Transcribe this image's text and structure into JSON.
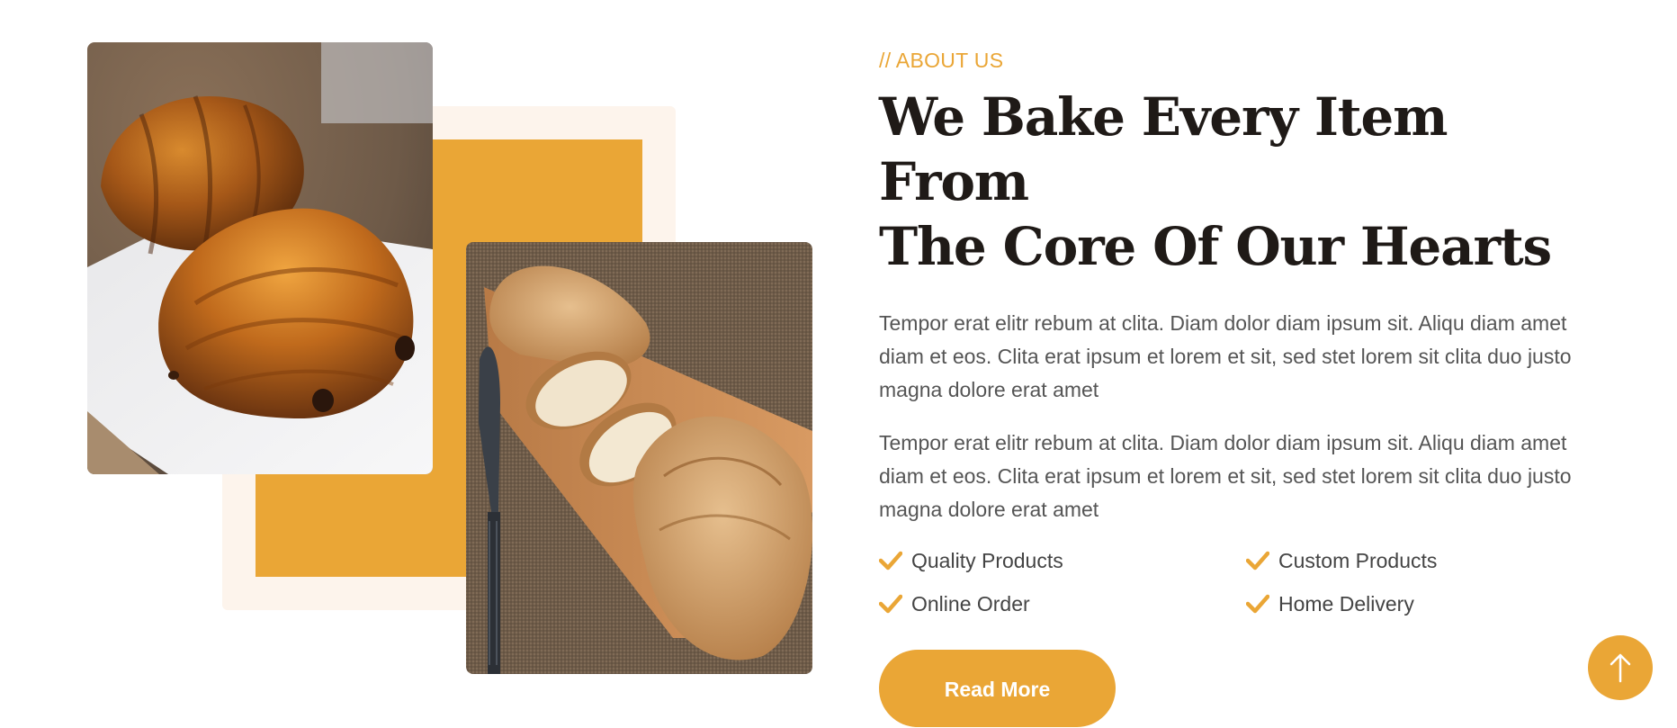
{
  "about": {
    "eyebrow": "// ABOUT US",
    "heading_line1": "We Bake Every Item From",
    "heading_line2": "The Core Of Our Hearts",
    "paragraph1": "Tempor erat elitr rebum at clita. Diam dolor diam ipsum sit. Aliqu diam amet diam et eos. Clita erat ipsum et lorem et sit, sed stet lorem sit clita duo justo magna dolore erat amet",
    "paragraph2": "Tempor erat elitr rebum at clita. Diam dolor diam ipsum sit. Aliqu diam amet diam et eos. Clita erat ipsum et lorem et sit, sed stet lorem sit clita duo justo magna dolore erat amet",
    "features": [
      {
        "label": "Quality Products",
        "icon": "check-icon"
      },
      {
        "label": "Custom Products",
        "icon": "check-icon"
      },
      {
        "label": "Online Order",
        "icon": "check-icon"
      },
      {
        "label": "Home Delivery",
        "icon": "check-icon"
      }
    ],
    "read_more_label": "Read More"
  },
  "images": {
    "photo1": "croissant-photo",
    "photo2": "baguette-photo"
  },
  "back_to_top": {
    "icon": "arrow-up-icon"
  },
  "colors": {
    "accent": "#eaa636",
    "cream": "#fdf4ec",
    "heading": "#1f1a17",
    "body_text": "#555555"
  }
}
